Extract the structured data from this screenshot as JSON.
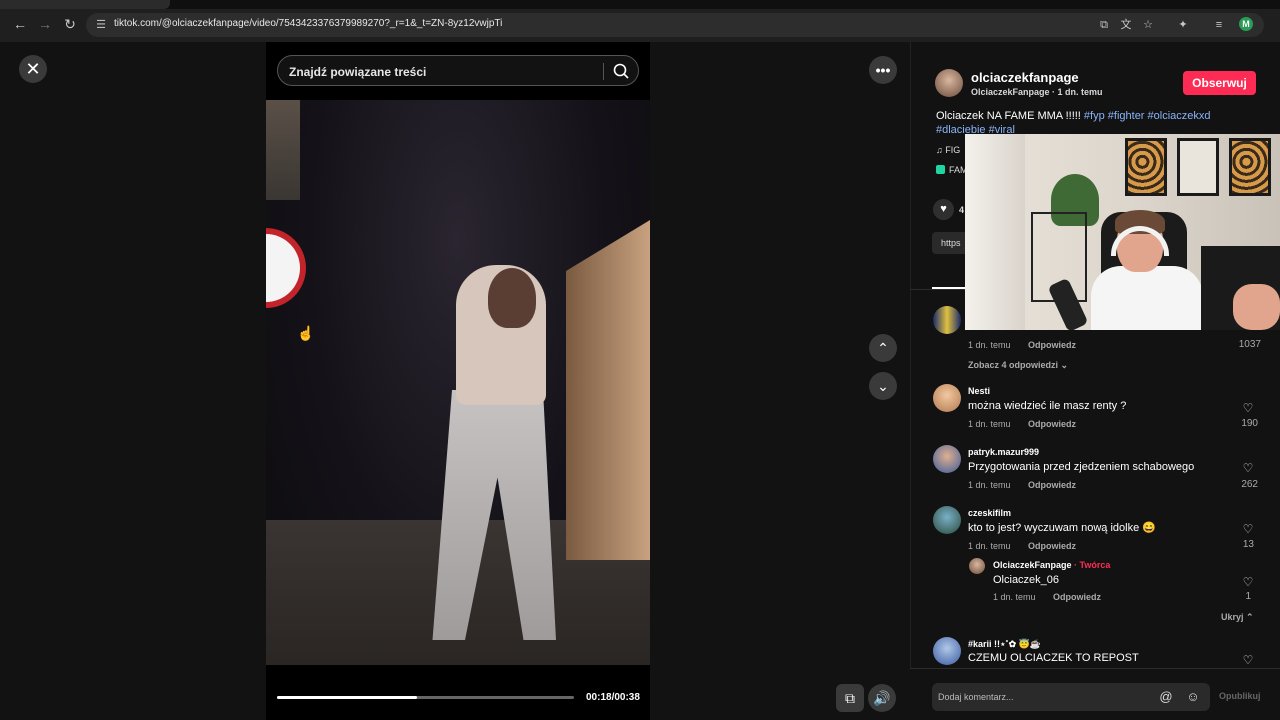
{
  "browser": {
    "url": "tiktok.com/@olciaczekfanpage/video/7543423376379989270?_r=1&_t=ZN-8yz12vwjpTi",
    "profile_initial": "M"
  },
  "viewer": {
    "search_placeholder": "Znajdź powiązane treści",
    "progress_percent": 47,
    "time": "00:18/00:38"
  },
  "post": {
    "author_name": "olciaczekfanpage",
    "author_sub": "OlciaczekFanpage · 1 dn. temu",
    "follow_label": "Obserwuj",
    "caption_text": "Olciaczek NA FAME MMA !!!!! ",
    "caption_tags": [
      "#fyp",
      "#fighter",
      "#olciaczekxd",
      "#dlaciebie",
      "#viral"
    ],
    "music_text": "FIG",
    "effect_text": "FAM",
    "likes_partial": "4",
    "link_partial": "https"
  },
  "comments": [
    {
      "user": "",
      "text": "",
      "time": "1 dn. temu",
      "reply": "Odpowiedz",
      "count": "1037"
    },
    {
      "user": "Nesti",
      "text": "można wiedzieć ile masz renty ?",
      "time": "1 dn. temu",
      "reply": "Odpowiedz",
      "count": "190"
    },
    {
      "user": "patryk.mazur999",
      "text": "Przygotowania przed zjedzeniem schabowego",
      "time": "1 dn. temu",
      "reply": "Odpowiedz",
      "count": "262"
    },
    {
      "user": "czeskifilm",
      "text": "kto to jest? wyczuwam nową idolke 😄",
      "time": "1 dn. temu",
      "reply": "Odpowiedz",
      "count": "13"
    },
    {
      "user": "#karii !!⋆˚✿ 😇☕",
      "text": "CZEMU OLCIACZEK TO REPOST",
      "time": "",
      "reply": "",
      "count": ""
    }
  ],
  "view_replies": "Zobacz 4 odpowiedzi",
  "reply": {
    "user": "OlciaczekFanpage",
    "badge": " · Twórca",
    "text": "Olciaczek_06",
    "time": "1 dn. temu",
    "reply": "Odpowiedz",
    "count": "1"
  },
  "hide_label": "Ukryj",
  "comment_box": {
    "placeholder": "Dodaj komentarz...",
    "publish_label": "Opublikuj"
  },
  "colors": {
    "accent": "#fe2c55",
    "hashtag": "#8ab4f8"
  }
}
